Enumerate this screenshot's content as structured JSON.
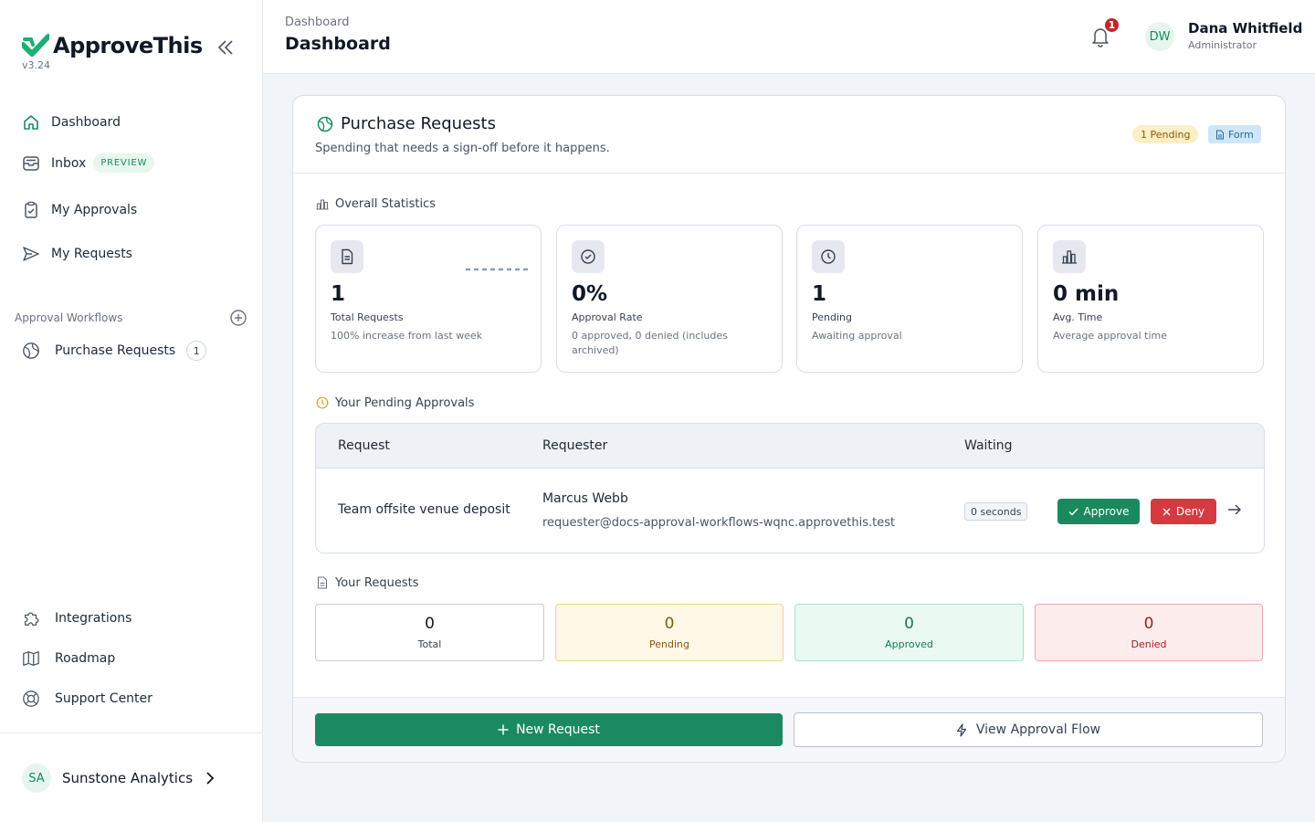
{
  "brand": {
    "name": "ApproveThis",
    "version": "v3.24"
  },
  "sidebar": {
    "nav": [
      {
        "label": "Dashboard",
        "icon": "home-icon"
      },
      {
        "label": "Inbox",
        "icon": "inbox-icon",
        "badge": "PREVIEW"
      },
      {
        "label": "My Approvals",
        "icon": "clipboard-check-icon"
      },
      {
        "label": "My Requests",
        "icon": "send-icon"
      }
    ],
    "workflows_label": "Approval Workflows",
    "workflows": [
      {
        "label": "Purchase Requests",
        "count": "1",
        "icon": "globe-icon"
      }
    ],
    "bottom": [
      {
        "label": "Integrations",
        "icon": "puzzle-icon"
      },
      {
        "label": "Roadmap",
        "icon": "map-icon"
      },
      {
        "label": "Support Center",
        "icon": "lifebuoy-icon"
      }
    ],
    "org": {
      "initials": "SA",
      "name": "Sunstone Analytics"
    }
  },
  "header": {
    "breadcrumb": "Dashboard",
    "title": "Dashboard",
    "notifications": "1",
    "user": {
      "initials": "DW",
      "name": "Dana Whitfield",
      "role": "Administrator"
    }
  },
  "workflow": {
    "title": "Purchase Requests",
    "subtitle": "Spending that needs a sign-off before it happens.",
    "pending_pill": "1 Pending",
    "form_pill": "Form",
    "stats_heading": "Overall Statistics",
    "stats": [
      {
        "value": "1",
        "label": "Total Requests",
        "desc": "100% increase from last week",
        "icon": "document-icon"
      },
      {
        "value": "0%",
        "label": "Approval Rate",
        "desc": "0 approved, 0 denied (includes archived)",
        "icon": "check-circle-icon"
      },
      {
        "value": "1",
        "label": "Pending",
        "desc": "Awaiting approval",
        "icon": "clock-icon"
      },
      {
        "value": "0 min",
        "label": "Avg. Time",
        "desc": "Average approval time",
        "icon": "bar-chart-icon"
      }
    ],
    "pending_heading": "Your Pending Approvals",
    "table": {
      "columns": [
        "Request",
        "Requester",
        "Waiting"
      ],
      "rows": [
        {
          "request": "Team offsite venue deposit",
          "requester_name": "Marcus Webb",
          "requester_email": "requester@docs-approval-workflows-wqnc.approvethis.test",
          "waiting": "0 seconds",
          "approve": "Approve",
          "deny": "Deny"
        }
      ]
    },
    "your_requests_heading": "Your Requests",
    "your_requests": [
      {
        "value": "0",
        "label": "Total"
      },
      {
        "value": "0",
        "label": "Pending"
      },
      {
        "value": "0",
        "label": "Approved"
      },
      {
        "value": "0",
        "label": "Denied"
      }
    ],
    "new_request": "New Request",
    "view_flow": "View Approval Flow"
  },
  "colors": {
    "brand": "#1b8a63",
    "deny": "#d63a40",
    "pending_bg": "#fff8e6",
    "approved_bg": "#eafaf3",
    "denied_bg": "#fdecec"
  }
}
